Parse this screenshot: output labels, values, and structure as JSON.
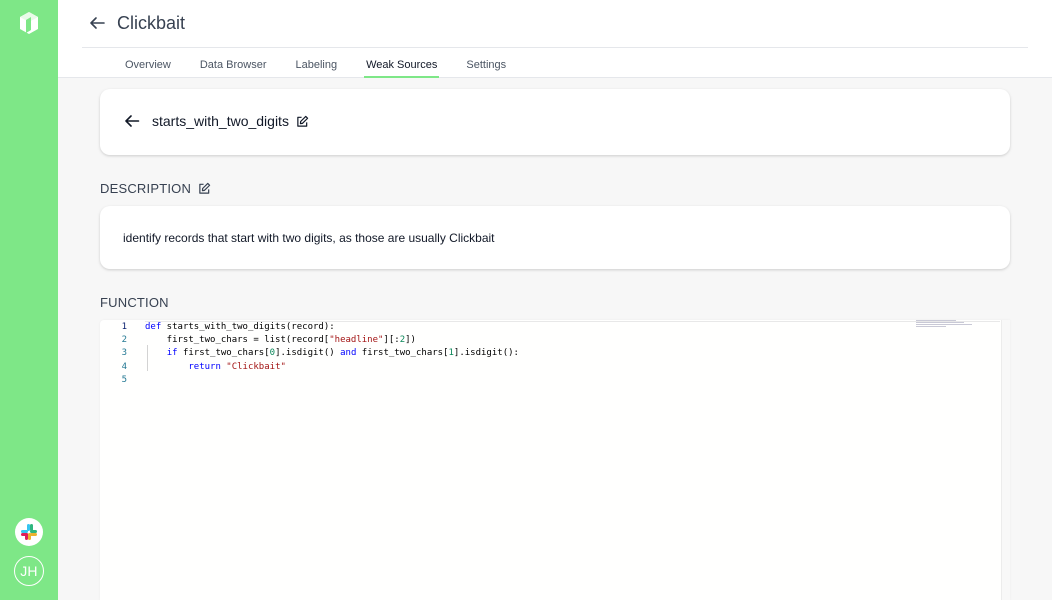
{
  "app": {
    "title": "Clickbait",
    "user_initials": "JH"
  },
  "tabs": [
    {
      "label": "Overview",
      "active": false
    },
    {
      "label": "Data Browser",
      "active": false
    },
    {
      "label": "Labeling",
      "active": false
    },
    {
      "label": "Weak Sources",
      "active": true
    },
    {
      "label": "Settings",
      "active": false
    }
  ],
  "weak_source": {
    "name": "starts_with_two_digits",
    "description_label": "DESCRIPTION",
    "description": "identify records that start with two digits, as those are usually Clickbait",
    "function_label": "FUNCTION"
  },
  "code_lines": [
    {
      "n": "1",
      "text": "def starts_with_two_digits(record):"
    },
    {
      "n": "2",
      "text": "    first_two_chars = list(record[\"headline\"][:2])"
    },
    {
      "n": "3",
      "text": "    if first_two_chars[0].isdigit() and first_two_chars[1].isdigit():"
    },
    {
      "n": "4",
      "text": "        return \"Clickbait\""
    },
    {
      "n": "5",
      "text": ""
    }
  ],
  "colors": {
    "sidebar": "#7ee787",
    "accent": "#7ee787",
    "keyword": "#0000ff",
    "string": "#a31515",
    "number": "#098658"
  },
  "icons": [
    "logo-icon",
    "back-arrow-icon",
    "edit-icon",
    "slack-icon"
  ]
}
